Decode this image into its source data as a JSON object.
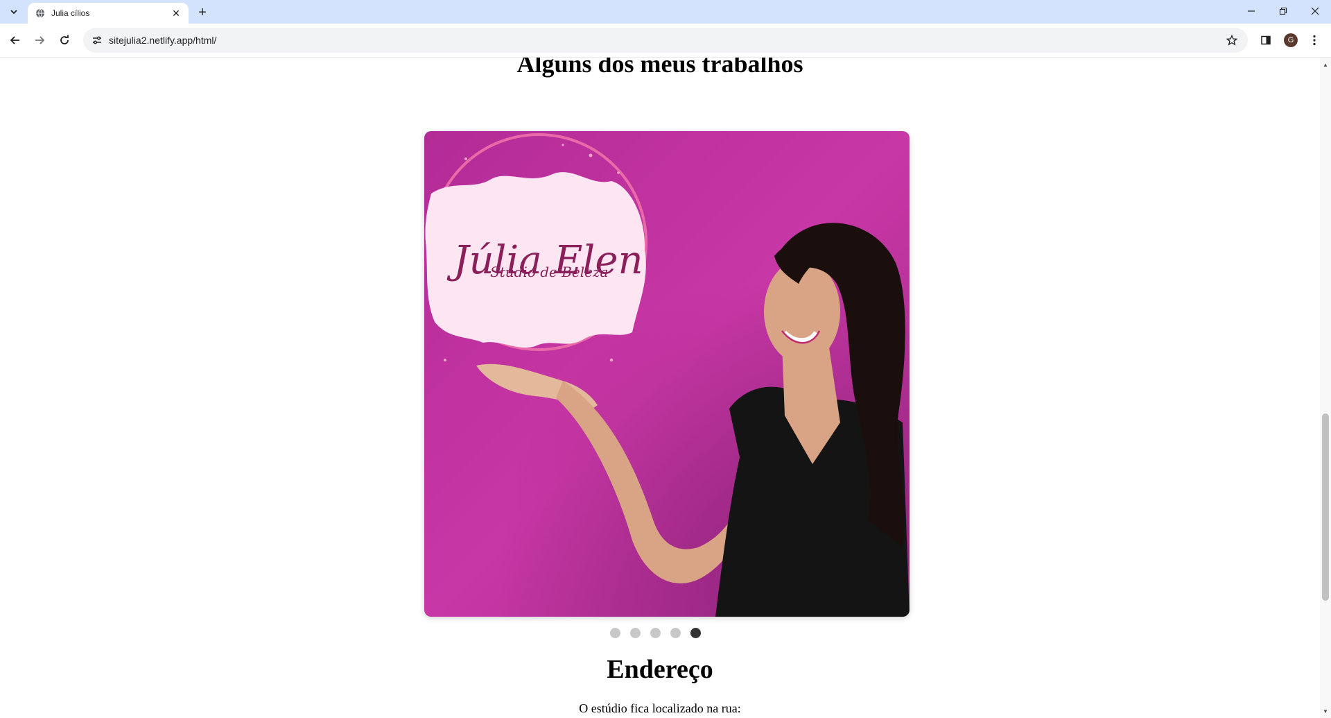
{
  "browser": {
    "tab_title": "Julia cílios",
    "url": "sitejulia2.netlify.app/html/",
    "profile_initial": "G"
  },
  "page": {
    "works_heading": "Alguns dos meus trabalhos",
    "carousel": {
      "logo_name": "Júlia Elen",
      "logo_subtitle": "Studio de Beleza",
      "slide_count": 5,
      "active_slide": 5,
      "background_color": "#c4309e"
    },
    "address_heading": "Endereço",
    "address_intro": "O estúdio fica localizado na rua:"
  }
}
